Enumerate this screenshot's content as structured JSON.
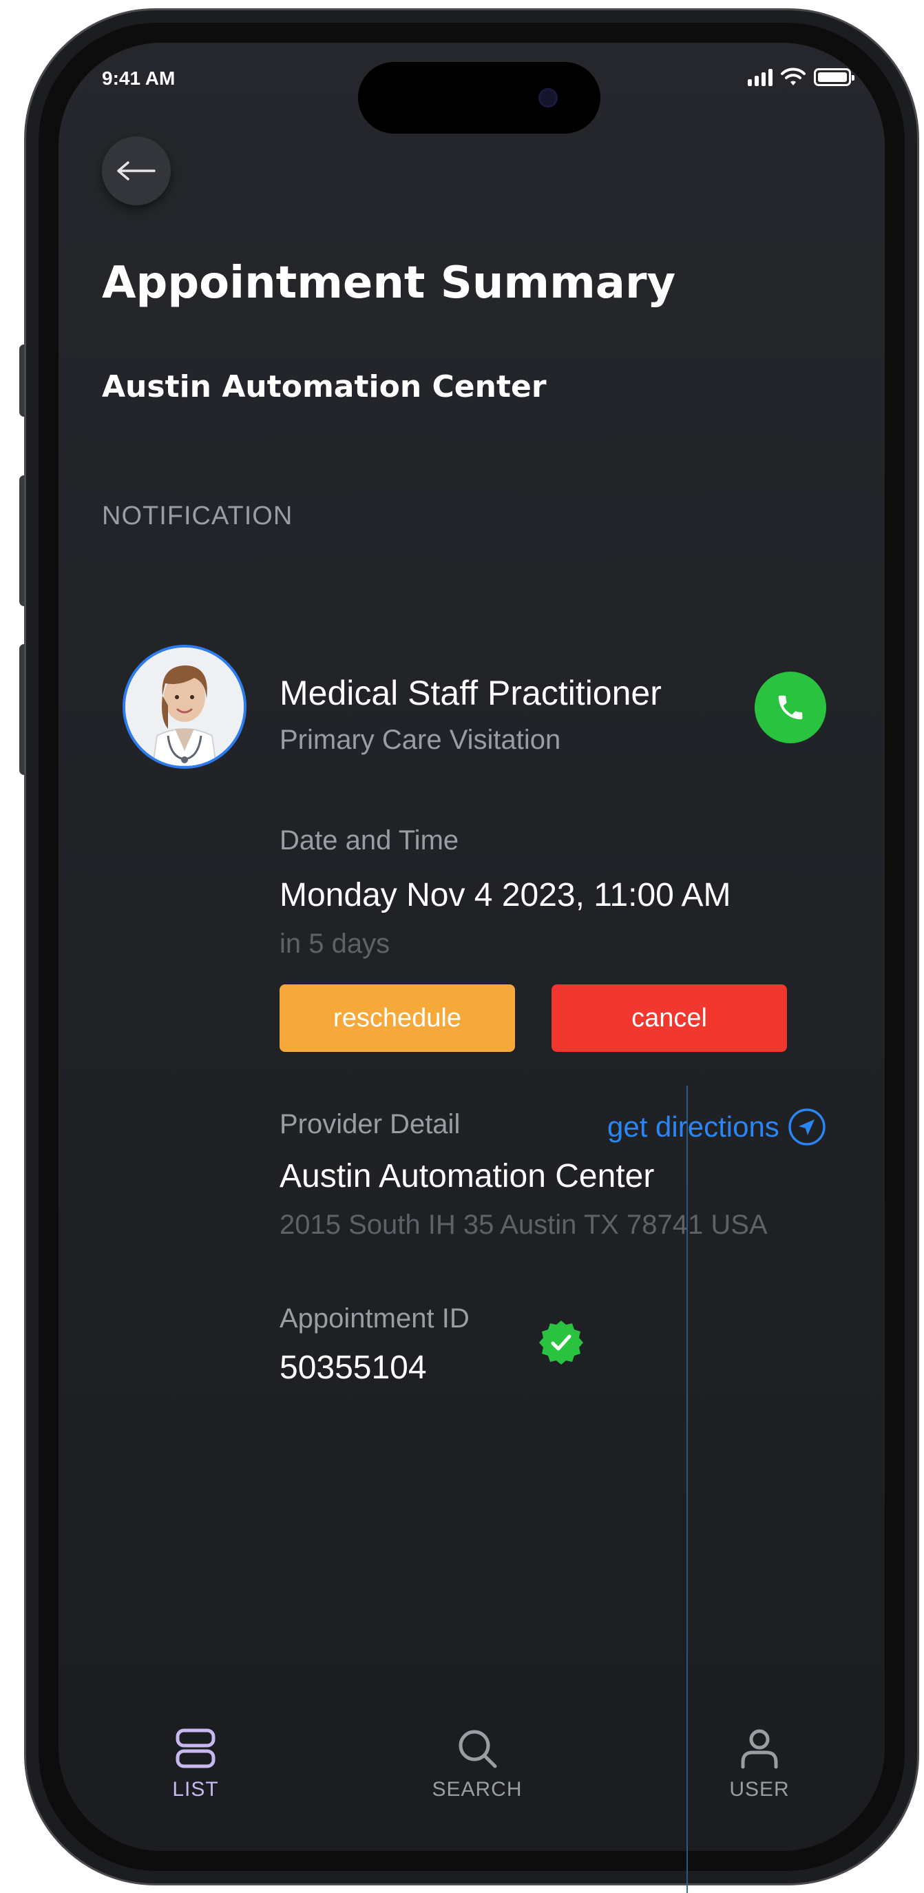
{
  "status": {
    "time": "9:41 AM"
  },
  "header": {
    "title": "Appointment Summary",
    "subtitle": "Austin Automation Center"
  },
  "section_label": "NOTIFICATION",
  "provider": {
    "name": "Medical Staff Practitioner",
    "type": "Primary Care Visitation"
  },
  "appointment": {
    "date_label": "Date and Time",
    "date_value": "Monday Nov 4 2023, 11:00 AM",
    "relative": "in 5 days",
    "reschedule_label": "reschedule",
    "cancel_label": "cancel",
    "provider_detail_label": "Provider Detail",
    "directions_label": "get directions",
    "location_name": "Austin Automation Center",
    "address": "2015 South IH 35 Austin TX 78741 USA",
    "id_label": "Appointment ID",
    "id_value": "50355104"
  },
  "tabs": [
    {
      "label": "LIST",
      "icon": "list-icon"
    },
    {
      "label": "SEARCH",
      "icon": "search-icon"
    },
    {
      "label": "USER",
      "icon": "user-icon"
    }
  ],
  "colors": {
    "background": "#25272c",
    "reschedule": "#f6a83a",
    "cancel": "#f2372e",
    "call": "#29c33f",
    "link": "#2a86f5",
    "tab_active": "#c8b8f0",
    "tab_inactive": "#9a9da3"
  }
}
